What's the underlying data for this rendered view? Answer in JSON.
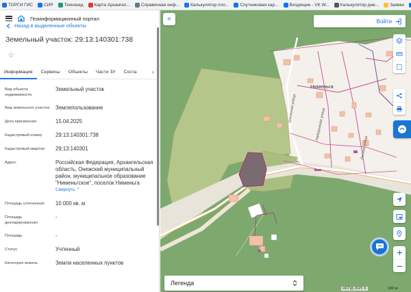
{
  "bookmarks": [
    {
      "label": "ТОРГИ ГИС",
      "color": "#2b6cd3"
    },
    {
      "label": "СИР",
      "color": "#1a73e8"
    },
    {
      "label": "Технокад",
      "color": "#1b9e77"
    },
    {
      "label": "Карта Архангел...",
      "color": "#e53935"
    },
    {
      "label": "Справочная инф...",
      "color": "#607d8b"
    },
    {
      "label": "Калькулятор пло...",
      "color": "#1a73e8"
    },
    {
      "label": "Спутниковая кар...",
      "color": "#1a73e8"
    },
    {
      "label": "Входящие - VK W...",
      "color": "#0077ff"
    },
    {
      "label": "Калькулятор дне...",
      "color": "#455a64"
    },
    {
      "label": "Заявки",
      "color": "#fbc02d"
    },
    {
      "label": "(1) Со...",
      "color": "#0077ff"
    }
  ],
  "header": {
    "portal_title": "Геоинформационный портал"
  },
  "nav": {
    "back_label": "Назад в выделенные объекты"
  },
  "object": {
    "title": "Земельный участок: 29:13:140301:738"
  },
  "tabs": [
    {
      "label": "Информация",
      "active": true
    },
    {
      "label": "Сервисы",
      "active": false
    },
    {
      "label": "Объекты",
      "active": false
    },
    {
      "label": "Части ЗУ",
      "active": false
    },
    {
      "label": "Соста",
      "active": false
    }
  ],
  "properties": [
    {
      "key": "Вид объекта недвижимости",
      "value": "Земельный участок"
    },
    {
      "key": "Вид земельного участка",
      "value": "Землепользование"
    },
    {
      "key": "Дата присвоения",
      "value": "15.04.2025"
    },
    {
      "key": "Кадастровый номер",
      "value": "29:13:140301:738"
    },
    {
      "key": "Кадастровый квартал",
      "value": "29:13:140301"
    },
    {
      "key": "Адрес",
      "value": "Российская Федерация, Архангельская область, Онежский муниципальный район, муниципальное образование \"Нименьгское\", поселок Нименьга",
      "action": "Свернуть ⌃"
    },
    {
      "key": "Площадь уточненная",
      "value": "10 000 кв. м"
    },
    {
      "key": "Площадь декларированная",
      "value": "-"
    },
    {
      "key": "Площадь",
      "value": "-"
    },
    {
      "key": "Статус",
      "value": "Учтенный"
    },
    {
      "key": "Категория земель",
      "value": "Земли населенных пунктов"
    }
  ],
  "map": {
    "login_label": "Войти",
    "legend_label": "Легенда",
    "place_label": "Нименьга",
    "streets": [
      "Школьная улица",
      "Набережная улица",
      "Лесная улица",
      "Пу..."
    ],
    "attribution": "НСПД 2025 ©",
    "scale": "100 м",
    "colors": {
      "forest": "#7da96f",
      "settlement": "#f4f0ec",
      "parcel_border": "#a3326b",
      "highlight": "#1976d2"
    }
  }
}
